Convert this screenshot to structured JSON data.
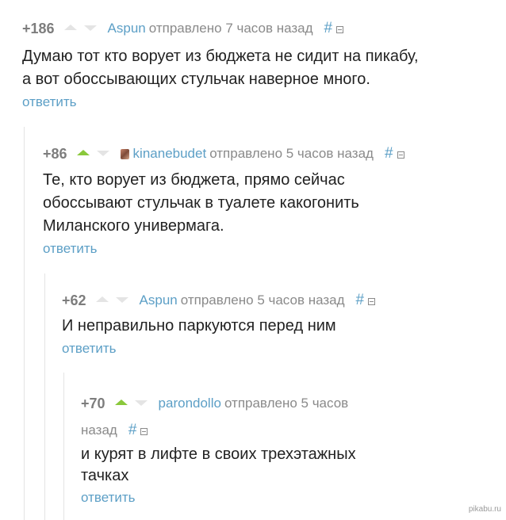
{
  "comments": [
    {
      "rating": "+186",
      "author": "Aspun",
      "sent": "отправлено 7 часов назад",
      "hash": "#",
      "lines": [
        "Думаю тот кто ворует из бюджета не сидит на пикабу,",
        "а вот обоссывающих стульчак наверное много."
      ],
      "reply": "ответить"
    },
    {
      "rating": "+86",
      "author": "kinanebudet",
      "sent": "отправлено 5 часов назад",
      "hash": "#",
      "lines": [
        "Те, кто ворует из бюджета, прямо сейчас",
        "обоссывают стульчак в туалете какогонить",
        "Миланского универмага."
      ],
      "reply": "ответить"
    },
    {
      "rating": "+62",
      "author": "Aspun",
      "sent": "отправлено 5 часов назад",
      "hash": "#",
      "lines": [
        "И неправильно паркуются перед ним"
      ],
      "reply": "ответить"
    },
    {
      "rating": "+70",
      "author": "parondollo",
      "sent": "отправлено 5 часов",
      "sent_cont": "назад",
      "hash": "#",
      "lines": [
        "и курят в лифте в своих трехэтажных",
        "тачках"
      ],
      "reply": "ответить"
    }
  ],
  "watermark": "pikabu.ru",
  "colors": {
    "link": "#5c9fc6",
    "upvote_active": "#8ac83b",
    "rating": "#7d7d7d",
    "meta": "#8a8a8a"
  },
  "icons": {
    "upvote": "triangle-up-icon",
    "downvote": "triangle-down-icon",
    "collapse": "minus-box-icon"
  }
}
